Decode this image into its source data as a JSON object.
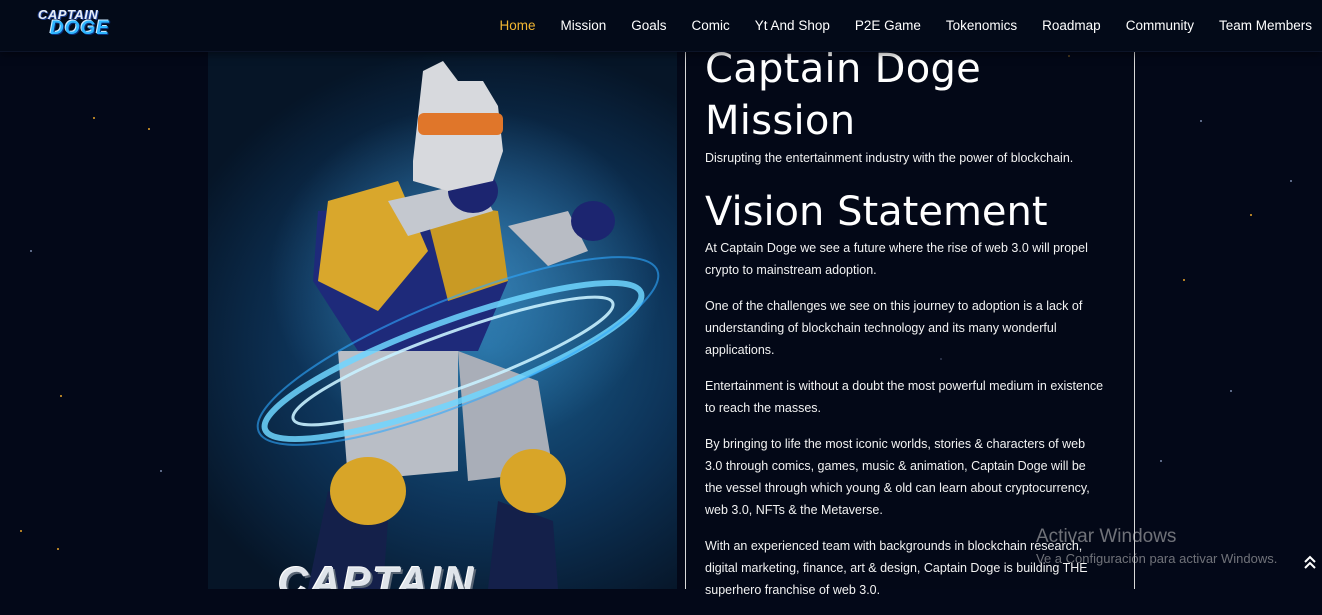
{
  "brand": {
    "logo_top": "CAPTAIN",
    "logo_bottom": "DOGE"
  },
  "nav": {
    "items": [
      {
        "label": "Home",
        "active": true
      },
      {
        "label": "Mission",
        "active": false
      },
      {
        "label": "Goals",
        "active": false
      },
      {
        "label": "Comic",
        "active": false
      },
      {
        "label": "Yt And Shop",
        "active": false
      },
      {
        "label": "P2E Game",
        "active": false
      },
      {
        "label": "Tokenomics",
        "active": false
      },
      {
        "label": "Roadmap",
        "active": false
      },
      {
        "label": "Community",
        "active": false
      },
      {
        "label": "Team Members",
        "active": false
      }
    ],
    "active_color": "#f2b632"
  },
  "hero": {
    "image_caption": "CAPTAIN"
  },
  "mission": {
    "title": "Captain Doge Mission",
    "text": "Disrupting the entertainment industry with the power of blockchain."
  },
  "vision": {
    "title": "Vision Statement",
    "paragraphs": [
      "At Captain Doge we see a future where the rise of web 3.0 will propel crypto to mainstream adoption.",
      "One of the challenges we see on this journey to adoption is a lack of understanding of blockchain technology and its many wonderful applications.",
      "Entertainment is without a doubt the most powerful medium in existence to reach the masses.",
      "By bringing to life the most iconic worlds, stories & characters of web 3.0 through comics, games, music & animation, Captain Doge will be the vessel through which young & old can learn about cryptocurrency, web 3.0, NFTs & the Metaverse.",
      "With an experienced team with backgrounds in blockchain research, digital marketing, finance, art & design, Captain Doge is building THE superhero franchise of web 3.0."
    ]
  },
  "watermark": {
    "title": "Activar Windows",
    "subtitle": "Ve a Configuración para activar Windows."
  },
  "scroll_top": {
    "icon": "double-chevron-up-icon"
  }
}
